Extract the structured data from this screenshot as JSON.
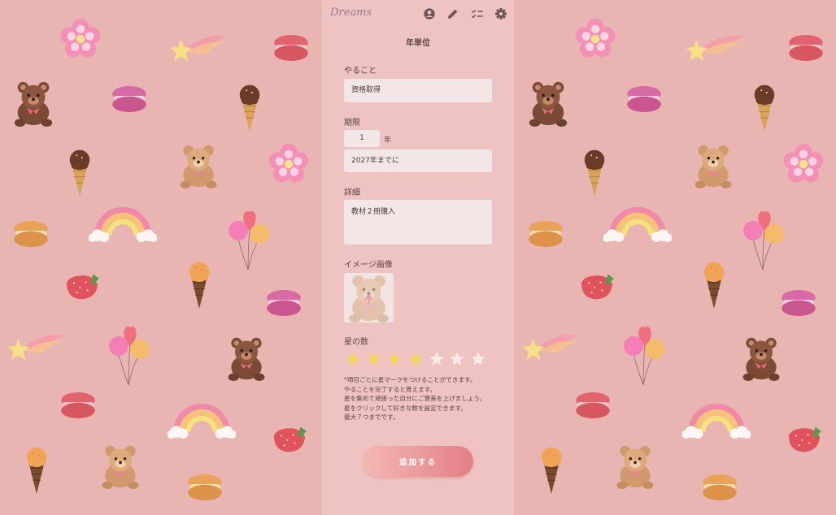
{
  "header": {
    "logo": "Dreams",
    "icons": [
      "account-circle-icon",
      "pencil-icon",
      "checklist-icon",
      "gear-icon"
    ]
  },
  "form": {
    "title": "年単位",
    "todo": {
      "label": "やること",
      "value": "資格取得"
    },
    "deadline": {
      "label": "期限",
      "years_value": "1",
      "years_unit": "年",
      "by_text": "2027年までに"
    },
    "detail": {
      "label": "詳細",
      "value": "教材２冊購入"
    },
    "image": {
      "label": "イメージ画像",
      "icon": "teddy-bear-upload-icon"
    },
    "stars": {
      "label": "星の数",
      "filled": 4,
      "max": 7
    },
    "hint_lines": [
      "*項目ごとに星マークをつけることができます。",
      "やることを完了すると貰えます。",
      "星を集めて頑張った自分にご褒美を上げましょう。",
      "星をクリックして好きな数を設定できます。",
      "最大７つまでです。"
    ],
    "submit_label": "追加する"
  },
  "colors": {
    "background": "#e9b5b3",
    "panel": "#efc3c1",
    "field": "#f3e6e7",
    "star_filled": "#f4d35e",
    "star_empty": "#f6eaea",
    "button_start": "#f4b7b3",
    "button_end": "#e37f88"
  },
  "background_decorations": [
    "flower-icon",
    "shooting-star-icon",
    "macaron-icon",
    "teddy-bear-icon",
    "ice-cream-icon",
    "rainbow-icon",
    "balloons-icon",
    "strawberry-icon"
  ]
}
